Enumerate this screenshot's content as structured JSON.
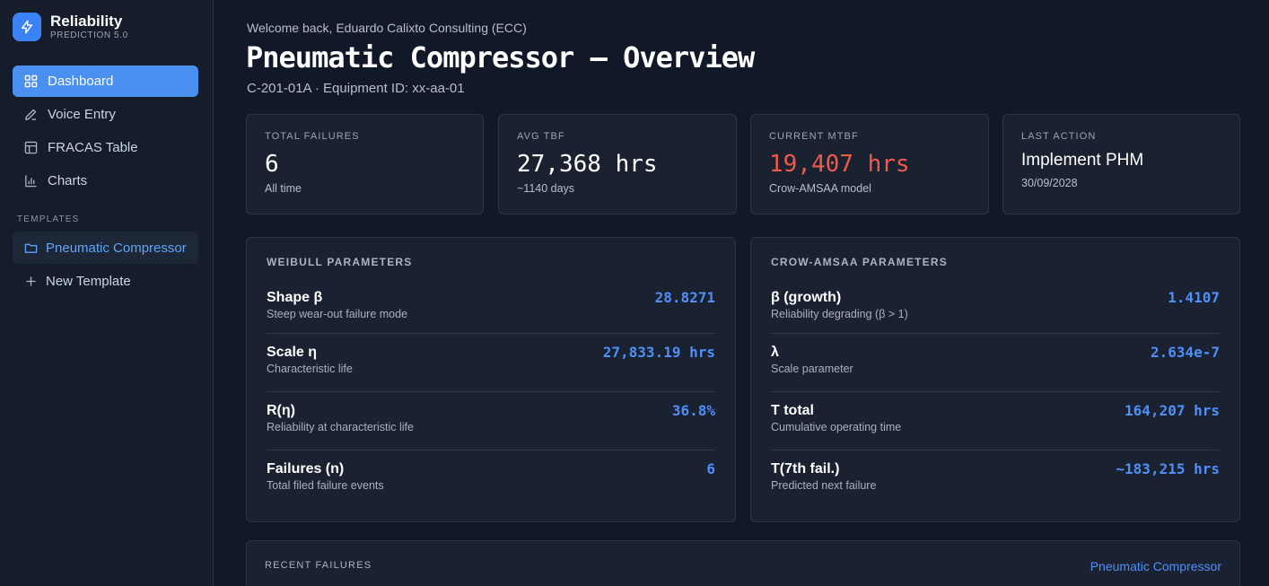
{
  "app": {
    "name": "Reliability",
    "version": "PREDICTION 5.0",
    "logo_icon": "lightning-bolt-icon"
  },
  "sidebar": {
    "nav": [
      {
        "label": "Dashboard",
        "icon": "grid-icon",
        "active": true
      },
      {
        "label": "Voice Entry",
        "icon": "pencil-icon",
        "active": false
      },
      {
        "label": "FRACAS Table",
        "icon": "table-icon",
        "active": false
      },
      {
        "label": "Charts",
        "icon": "bar-chart-icon",
        "active": false
      }
    ],
    "templates_label": "TEMPLATES",
    "templates": [
      {
        "label": "Pneumatic Compressor",
        "icon": "folder-icon",
        "active": true
      },
      {
        "label": "New Template",
        "icon": "plus-icon",
        "active": false
      }
    ]
  },
  "header": {
    "welcome": "Welcome back, Eduardo Calixto Consulting (ECC)",
    "title": "Pneumatic Compressor — Overview",
    "subtitle": "C-201-01A · Equipment ID: xx-aa-01"
  },
  "stats": [
    {
      "label": "TOTAL FAILURES",
      "value": "6",
      "sub": "All time"
    },
    {
      "label": "AVG TBF",
      "value": "27,368 hrs",
      "sub": "~1140 days"
    },
    {
      "label": "CURRENT MTBF",
      "value": "19,407 hrs",
      "sub": "Crow-AMSAA model"
    },
    {
      "label": "LAST ACTION",
      "value": "Implement PHM",
      "sub": "30/09/2028"
    }
  ],
  "weibull": {
    "title": "WEIBULL PARAMETERS",
    "rows": [
      {
        "name": "Shape β",
        "desc": "Steep wear-out failure mode",
        "value": "28.8271"
      },
      {
        "name": "Scale η",
        "desc": "Characteristic life",
        "value": "27,833.19 hrs"
      },
      {
        "name": "R(η)",
        "desc": "Reliability at characteristic life",
        "value": "36.8%"
      },
      {
        "name": "Failures (n)",
        "desc": "Total filed failure events",
        "value": "6"
      }
    ]
  },
  "crow": {
    "title": "CROW-AMSAA PARAMETERS",
    "rows": [
      {
        "name": "β (growth)",
        "desc": "Reliability degrading (β > 1)",
        "value": "1.4107"
      },
      {
        "name": "λ",
        "desc": "Scale parameter",
        "value": "2.634e-7"
      },
      {
        "name": "T total",
        "desc": "Cumulative operating time",
        "value": "164,207 hrs"
      },
      {
        "name": "T(7th fail.)",
        "desc": "Predicted next failure",
        "value": "~183,215 hrs"
      }
    ]
  },
  "recent": {
    "title": "RECENT FAILURES",
    "link": "Pneumatic Compressor"
  },
  "colors": {
    "accent": "#4a90f0",
    "value_blue": "#4f8ff7",
    "alert_red": "#ef5a4b",
    "background": "#111827"
  }
}
